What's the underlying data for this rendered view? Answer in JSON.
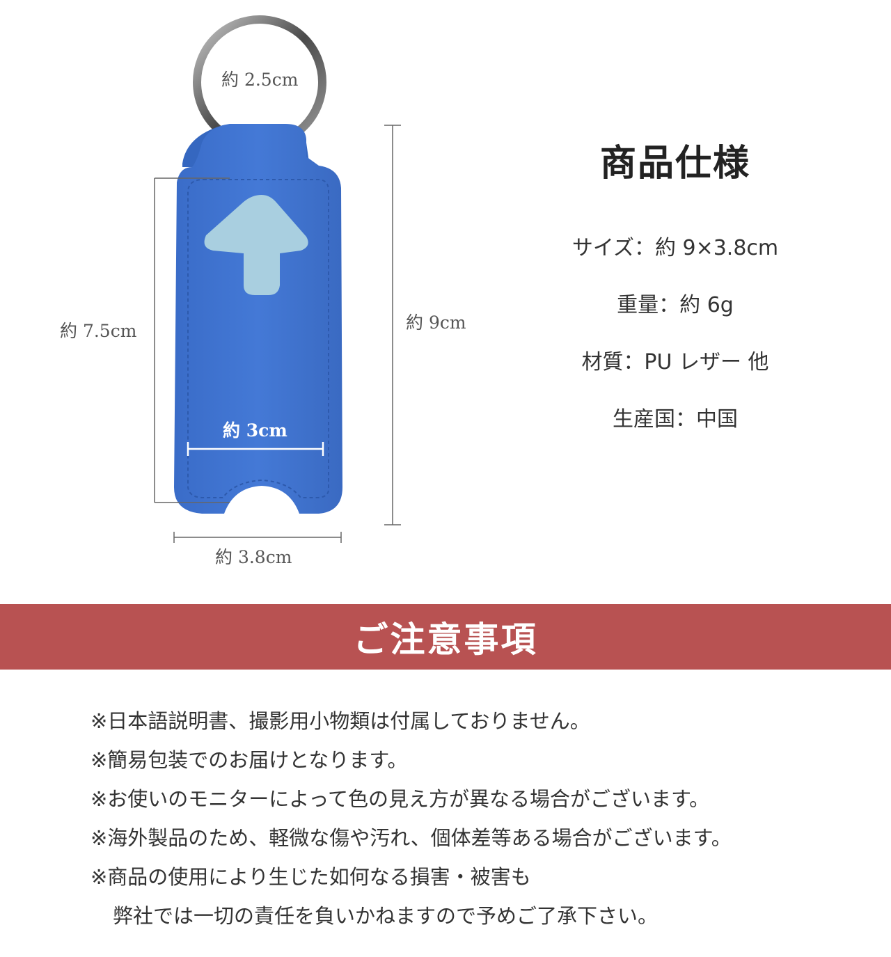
{
  "dimensions": {
    "ring_diameter": "約 2.5cm",
    "inner_height": "約 7.5cm",
    "total_height": "約 9cm",
    "inner_width": "約 3cm",
    "total_width": "約 3.8cm"
  },
  "specs": {
    "title": "商品仕様",
    "size": "サイズ：約 9×3.8cm",
    "weight": "重量：約 6g",
    "material": "材質：PU レザー 他",
    "origin": "生産国：中国"
  },
  "notice": {
    "title": "ご注意事項",
    "lines": [
      "※日本語説明書、撮影用小物類は付属しておりません。",
      "※簡易包装でのお届けとなります。",
      "※お使いのモニターによって色の見え方が異なる場合がございます。",
      "※海外製品のため、軽微な傷や汚れ、個体差等ある場合がございます。",
      "※商品の使用により生じた如何なる損害・被害も",
      "弊社では一切の責任を負いかねますので予めご了承下さい。"
    ]
  },
  "colors": {
    "banner": "#b85252",
    "leather": "#3f74d3",
    "suede": "#a9cfe0"
  }
}
